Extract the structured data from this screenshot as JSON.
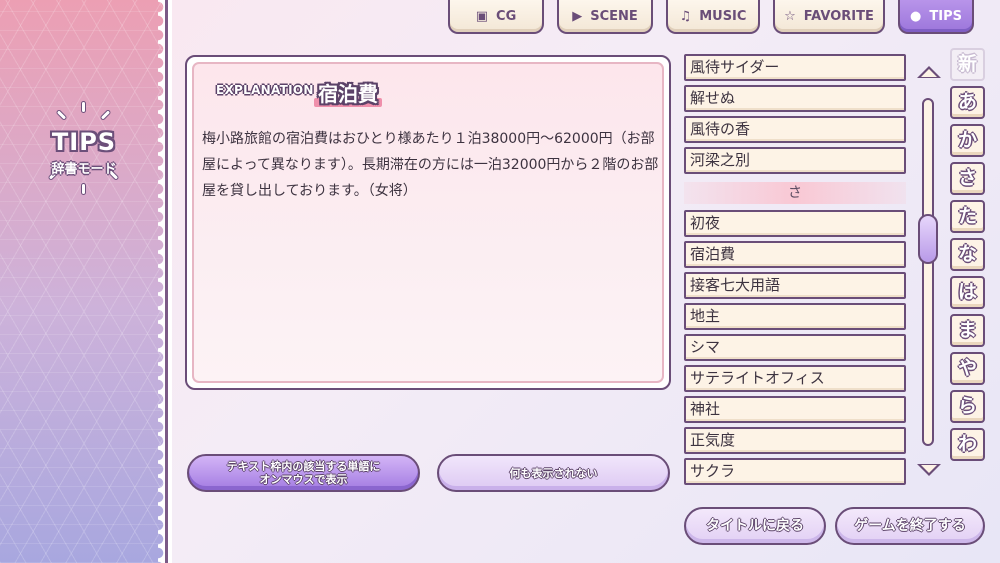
{
  "sidebar": {
    "logo_title": "TIPS",
    "logo_subtitle": "辞書モード"
  },
  "tabs": [
    {
      "label": "CG",
      "icon": "image-icon",
      "glyph": "▣",
      "active": false
    },
    {
      "label": "SCENE",
      "icon": "play-icon",
      "glyph": "▶",
      "active": false
    },
    {
      "label": "MUSIC",
      "icon": "music-note-icon",
      "glyph": "♫",
      "active": false
    },
    {
      "label": "FAVORITE",
      "icon": "star-icon",
      "glyph": "☆",
      "active": false
    },
    {
      "label": "TIPS",
      "icon": "lightbulb-icon",
      "glyph": "●",
      "active": true
    }
  ],
  "explanation": {
    "label": "EXPLANATION",
    "title": "宿泊費",
    "body": "梅小路旅館の宿泊費はおひとり様あたり１泊38000円～62000円（お部屋によって異なります）。長期滞在の方には一泊32000円から２階のお部屋を貸し出しております。（女将）"
  },
  "mode_buttons": {
    "hover_mode": "テキスト枠内の該当する単語に\nオンマウスで表示",
    "none_mode": "何も表示されない"
  },
  "word_list": {
    "items_before": [
      "風待サイダー",
      "解せぬ",
      "風待の香",
      "河梁之別"
    ],
    "section_header": "さ",
    "items_after": [
      "初夜",
      "宿泊費",
      "接客七大用語",
      "地主",
      "シマ",
      "サテライトオフィス",
      "神社",
      "正気度",
      "サクラ"
    ]
  },
  "kana_index": [
    "新",
    "あ",
    "か",
    "さ",
    "た",
    "な",
    "は",
    "ま",
    "や",
    "ら",
    "わ"
  ],
  "footer": {
    "title_button": "タイトルに戻る",
    "quit_button": "ゲームを終了する"
  }
}
